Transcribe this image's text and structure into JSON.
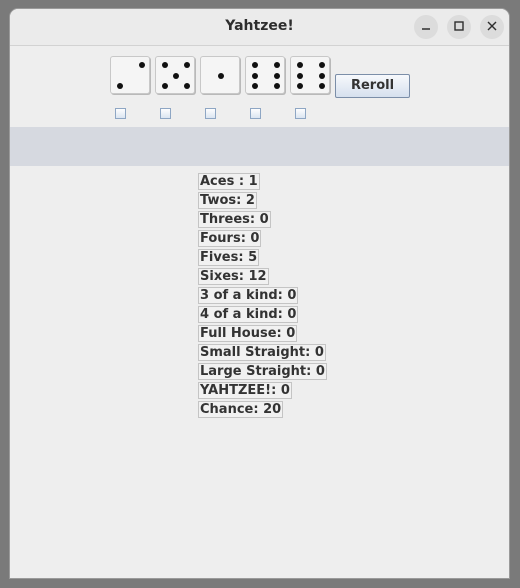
{
  "window": {
    "title": "Yahtzee!"
  },
  "dice": [
    {
      "value": 2,
      "held": false
    },
    {
      "value": 5,
      "held": false
    },
    {
      "value": 1,
      "held": false
    },
    {
      "value": 6,
      "held": false
    },
    {
      "value": 6,
      "held": false
    }
  ],
  "controls": {
    "reroll_label": "Reroll"
  },
  "scores": [
    "Aces : 1",
    "Twos: 2",
    "Threes: 0",
    "Fours: 0",
    "Fives: 5",
    "Sixes: 12",
    "3 of a kind: 0",
    "4 of a kind: 0",
    "Full House: 0",
    "Small Straight: 0",
    "Large Straight: 0",
    "YAHTZEE!: 0",
    "Chance: 20"
  ]
}
